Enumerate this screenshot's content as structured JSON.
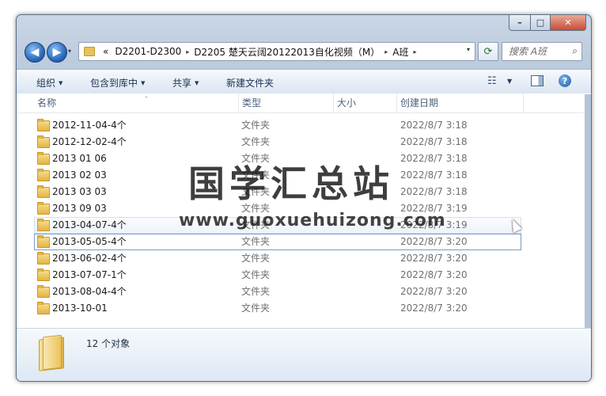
{
  "window": {
    "caption": {
      "min_glyph": "–",
      "max_glyph": "□",
      "close_glyph": "✕"
    }
  },
  "address_bar": {
    "recent_glyph": "▾",
    "overflow_glyph": "«",
    "crumbs": [
      "D2201-D2300",
      "D2205 楚天云阔20122013自化视频（M）",
      "A班"
    ],
    "separator_glyph": "▸",
    "dropdown_glyph": "▾",
    "refresh_glyph": "⟳"
  },
  "search": {
    "placeholder": "搜索 A班",
    "icon": "search-icon",
    "glyph": "⌕"
  },
  "toolbar": {
    "organize": "组织",
    "include_in_library": "包含到库中",
    "share": "共享",
    "new_folder": "新建文件夹",
    "arrow_glyph": "▼",
    "view_glyph": "☷",
    "help_glyph": "?"
  },
  "columns": {
    "name": "名称",
    "type": "类型",
    "size": "大小",
    "date_created": "创建日期",
    "sort_glyph": "˄"
  },
  "files": [
    {
      "name": "2012-11-04-4个",
      "type": "文件夹",
      "date": "2022/8/7 3:18"
    },
    {
      "name": "2012-12-02-4个",
      "type": "文件夹",
      "date": "2022/8/7 3:18"
    },
    {
      "name": "2013 01 06",
      "type": "文件夹",
      "date": "2022/8/7 3:18"
    },
    {
      "name": "2013 02 03",
      "type": "文件夹",
      "date": "2022/8/7 3:18"
    },
    {
      "name": "2013 03 03",
      "type": "文件夹",
      "date": "2022/8/7 3:18"
    },
    {
      "name": "2013 09 03",
      "type": "文件夹",
      "date": "2022/8/7 3:19"
    },
    {
      "name": "2013-04-07-4个",
      "type": "文件夹",
      "date": "2022/8/7 3:19"
    },
    {
      "name": "2013-05-05-4个",
      "type": "文件夹",
      "date": "2022/8/7 3:20"
    },
    {
      "name": "2013-06-02-4个",
      "type": "文件夹",
      "date": "2022/8/7 3:20"
    },
    {
      "name": "2013-07-07-1个",
      "type": "文件夹",
      "date": "2022/8/7 3:20"
    },
    {
      "name": "2013-08-04-4个",
      "type": "文件夹",
      "date": "2022/8/7 3:20"
    },
    {
      "name": "2013-10-01",
      "type": "文件夹",
      "date": "2022/8/7 3:20"
    }
  ],
  "details": {
    "count_text": "12 个对象"
  },
  "watermark": {
    "title": "国学汇总站",
    "url": "www.guoxuehuizong.com"
  },
  "state": {
    "hover_row": 6,
    "focus_row": 7
  }
}
